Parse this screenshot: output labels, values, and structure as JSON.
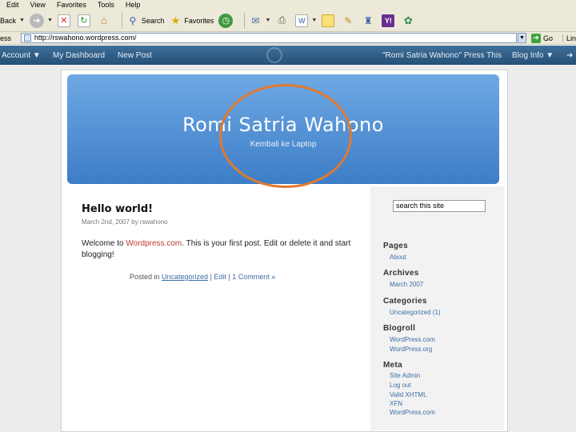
{
  "menu": [
    "Edit",
    "View",
    "Favorites",
    "Tools",
    "Help"
  ],
  "toolbar": {
    "back_label": "Back",
    "search_label": "Search",
    "favorites_label": "Favorites"
  },
  "address": {
    "label": "ess",
    "url": "http://rswahono.wordpress.com/",
    "go_label": "Go",
    "links_label": "Lin"
  },
  "wpbar": {
    "account": "Account ▼",
    "dashboard": "My Dashboard",
    "new_post": "New Post",
    "blog_name": "\"Romi Satria Wahono\"",
    "press_this": "Press This",
    "blog_info": "Blog Info ▼",
    "more": "➜"
  },
  "blog": {
    "title": "Romi Satria Wahono",
    "description": "Kembali ke Laptop"
  },
  "post": {
    "title": "Hello world!",
    "meta": "March 2nd, 2007 by rswahono",
    "body_pre": "Welcome to ",
    "body_link": "Wordpress.com",
    "body_post": ". This is your first post. Edit or delete it and start blogging!",
    "posted_in": "Posted in ",
    "category": "Uncategorized",
    "edit": "Edit",
    "sep": " | ",
    "comments": "1 Comment »"
  },
  "sidebar": {
    "search_value": "search this site",
    "pages_head": "Pages",
    "pages": [
      "About"
    ],
    "archives_head": "Archives",
    "archives": [
      "March 2007"
    ],
    "categories_head": "Categories",
    "categories": [
      "Uncategorized (1)"
    ],
    "blogroll_head": "Blogroll",
    "blogroll": [
      "WordPress.com",
      "WordPress.org"
    ],
    "meta_head": "Meta",
    "meta": [
      "Site Admin",
      "Log out",
      "Valid XHTML",
      "XFN",
      "WordPress.com"
    ]
  },
  "colors": {
    "header_top": "#6fa9e3",
    "header_bottom": "#3d7dc8",
    "annotation_circle": "#e07a2e",
    "link": "#3b6ea5",
    "wpbar": "#2f5e88"
  }
}
